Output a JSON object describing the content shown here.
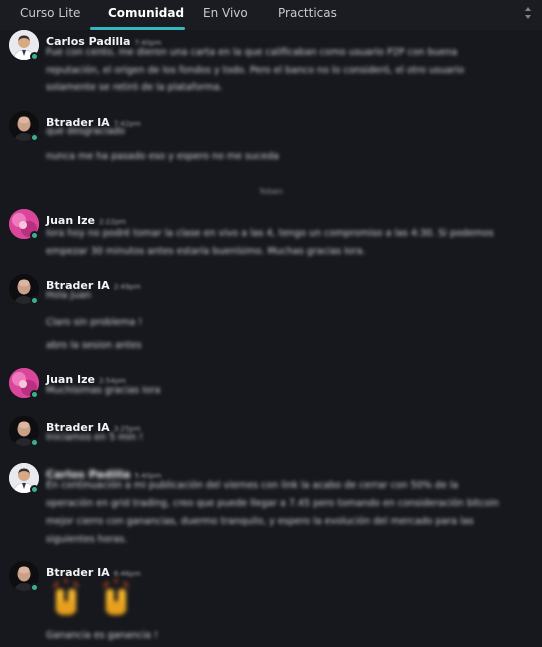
{
  "tabs": [
    {
      "label": "Curso Lite"
    },
    {
      "label": "Comunidad"
    },
    {
      "label": "En Vivo"
    },
    {
      "label": "Practticas"
    }
  ],
  "active_tab": "Comunidad",
  "accent_color": "#35b7c0",
  "online_color": "#3bb08f",
  "messages": [
    {
      "author": "Carlos Padilla",
      "time": "7:40pm",
      "avatar": "man-white-shirt-avatar",
      "lines": [
        "Fue con cento, me dieron una carta en la que calificaban como usuario P2P con buena",
        "reputación, el origen de los fondos y todo. Pero el banco no lo consideró, el otro usuario",
        "solamente se retiró de la plataforma."
      ]
    },
    {
      "author": "Btrader IA",
      "time": "7:42pm",
      "avatar": "bald-man-avatar",
      "lines": [
        "que desgraciado",
        "nunca me ha pasado eso y espero no me suceda"
      ]
    },
    {
      "divider": "Yoben"
    },
    {
      "author": "Juan Ize",
      "time": "2:22pm",
      "avatar": "pink-avatar",
      "lines": [
        "Iora hoy no podré tomar la clase en vivo a las 4, tengo un compromiso a las 4:30. Si podemos",
        "empezar 30 minutos antes estaría buenísimo. Muchas gracias Iora."
      ]
    },
    {
      "author": "Btrader IA",
      "time": "2:49pm",
      "avatar": "bald-man-avatar",
      "lines": [
        "Hola Juan",
        "Claro sin problema !",
        "abro la sesion antes"
      ]
    },
    {
      "author": "Juan Ize",
      "time": "2:54pm",
      "avatar": "pink-avatar",
      "lines": [
        "Muchísimas gracias Iora"
      ]
    },
    {
      "author": "Btrader IA",
      "time": "3:25pm",
      "avatar": "bald-man-avatar",
      "lines": [
        "Iniciamos en 5 min !"
      ]
    },
    {
      "author": "Carlos Padilla",
      "time": "5:40pm",
      "avatar": "man-white-shirt-avatar",
      "lines": [
        "En continuación a mi publicación del viernes con link la acabo de cerrar con 50% de la",
        "operación en grid trading, creo que puede llegar a 7.45 pero tomando en consideración bitcoin",
        "mejor cierro con ganancias, duermo tranquilo,  y espero la evolución del mercado para las",
        "siguientes horas."
      ]
    },
    {
      "author": "Btrader IA",
      "time": "6:46pm",
      "avatar": "bald-man-avatar",
      "emoji": "raising-hands-emoji",
      "lines": [
        "Ganancia es ganancia !"
      ]
    }
  ]
}
